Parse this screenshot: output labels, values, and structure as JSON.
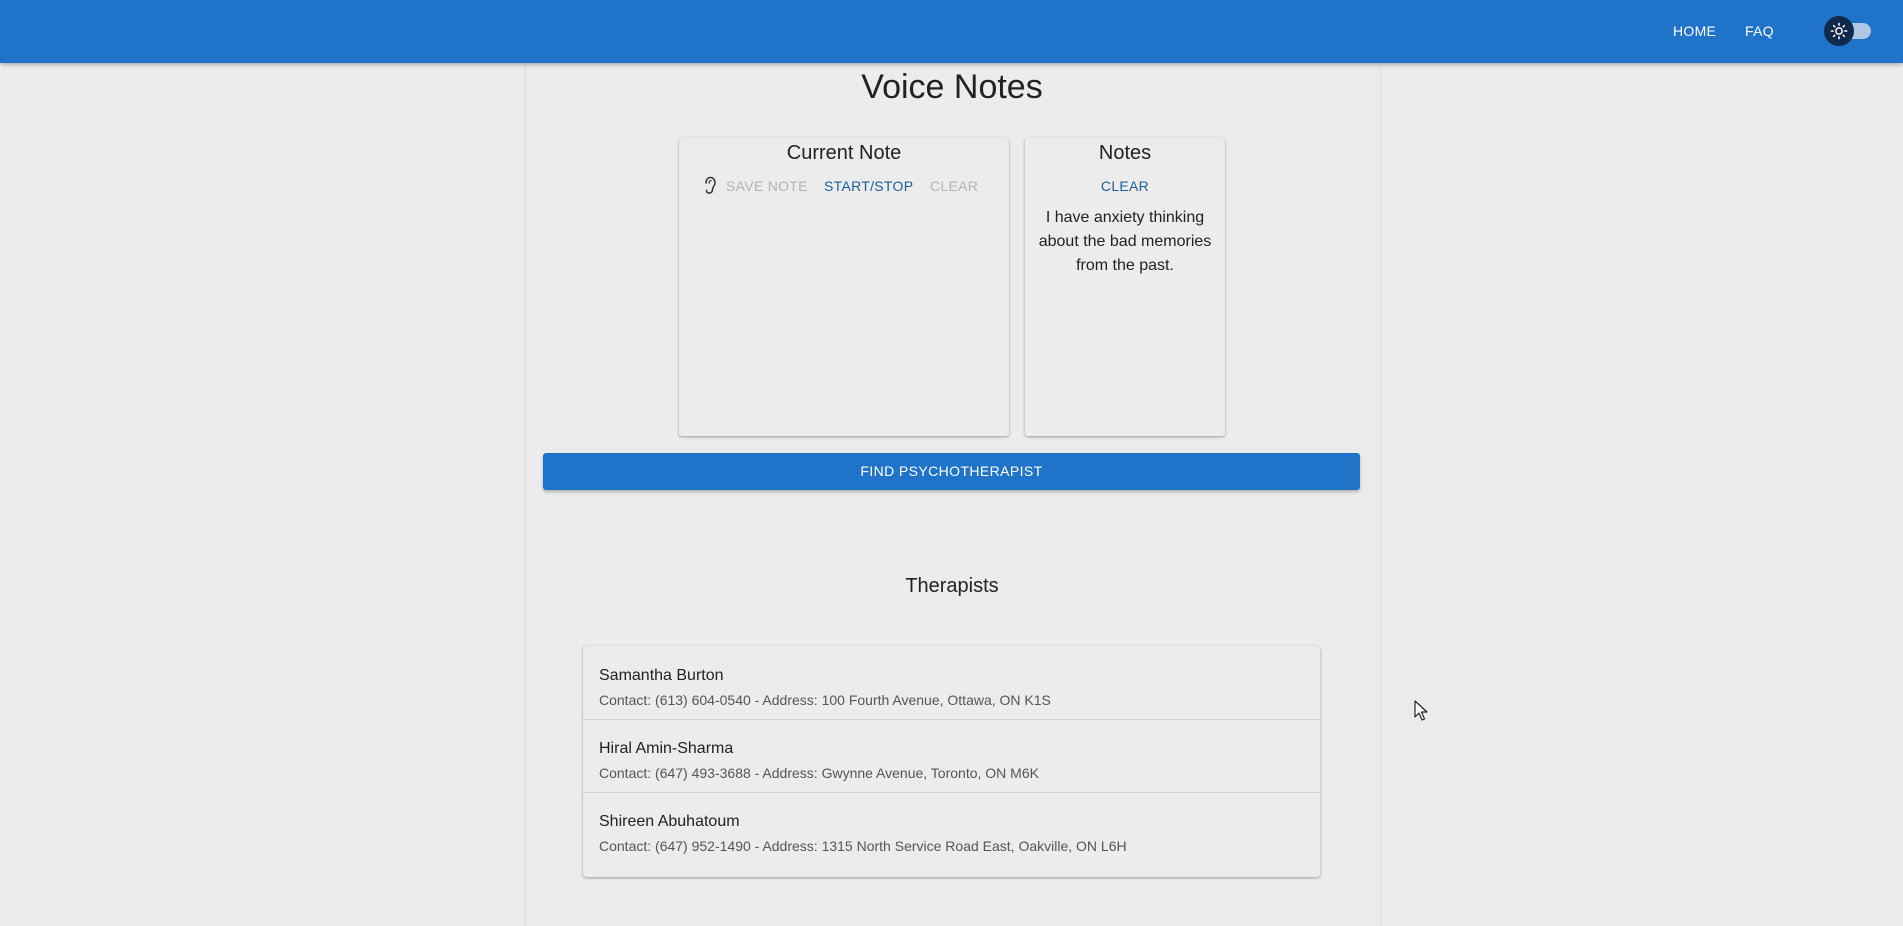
{
  "header": {
    "nav": [
      {
        "label": "HOME"
      },
      {
        "label": "FAQ"
      }
    ],
    "theme_toggle_icon": "sun-icon",
    "background_color": "#1f74c9"
  },
  "main": {
    "title": "Voice Notes",
    "current_note": {
      "heading": "Current Note",
      "mic_icon": "microphone-icon",
      "save_label": "SAVE NOTE",
      "start_stop_label": "START/STOP",
      "clear_label": "CLEAR"
    },
    "notes": {
      "heading": "Notes",
      "clear_label": "CLEAR",
      "items": [
        {
          "text": "I have anxiety thinking about the bad memories from the past."
        }
      ]
    },
    "find_button_label": "FIND PSYCHOTHERAPIST"
  },
  "therapists": {
    "title": "Therapists",
    "items": [
      {
        "name": "Samantha Burton",
        "detail": "Contact: (613) 604-0540 - Address: 100 Fourth Avenue, Ottawa, ON K1S"
      },
      {
        "name": "Hiral Amin-Sharma",
        "detail": "Contact: (647) 493-3688 - Address: Gwynne Avenue, Toronto, ON M6K"
      },
      {
        "name": "Shireen Abuhatoum",
        "detail": "Contact: (647) 952-1490 - Address: 1315 North Service Road East, Oakville, ON L6H"
      }
    ]
  },
  "colors": {
    "primary": "#1f74c9",
    "link_text": "#1c5e99",
    "disabled_text": "#b3b3b3",
    "page_background": "#ececec"
  }
}
